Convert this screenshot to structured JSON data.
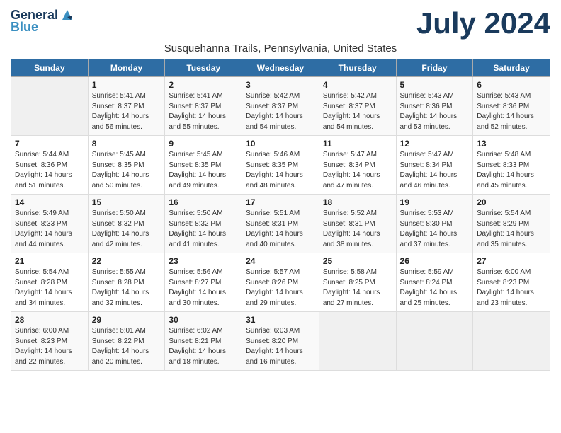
{
  "logo": {
    "text_general": "General",
    "text_blue": "Blue"
  },
  "title": "July 2024",
  "subtitle": "Susquehanna Trails, Pennsylvania, United States",
  "days_of_week": [
    "Sunday",
    "Monday",
    "Tuesday",
    "Wednesday",
    "Thursday",
    "Friday",
    "Saturday"
  ],
  "weeks": [
    [
      {
        "date": "",
        "info": ""
      },
      {
        "date": "1",
        "info": "Sunrise: 5:41 AM\nSunset: 8:37 PM\nDaylight: 14 hours\nand 56 minutes."
      },
      {
        "date": "2",
        "info": "Sunrise: 5:41 AM\nSunset: 8:37 PM\nDaylight: 14 hours\nand 55 minutes."
      },
      {
        "date": "3",
        "info": "Sunrise: 5:42 AM\nSunset: 8:37 PM\nDaylight: 14 hours\nand 54 minutes."
      },
      {
        "date": "4",
        "info": "Sunrise: 5:42 AM\nSunset: 8:37 PM\nDaylight: 14 hours\nand 54 minutes."
      },
      {
        "date": "5",
        "info": "Sunrise: 5:43 AM\nSunset: 8:36 PM\nDaylight: 14 hours\nand 53 minutes."
      },
      {
        "date": "6",
        "info": "Sunrise: 5:43 AM\nSunset: 8:36 PM\nDaylight: 14 hours\nand 52 minutes."
      }
    ],
    [
      {
        "date": "7",
        "info": "Sunrise: 5:44 AM\nSunset: 8:36 PM\nDaylight: 14 hours\nand 51 minutes."
      },
      {
        "date": "8",
        "info": "Sunrise: 5:45 AM\nSunset: 8:35 PM\nDaylight: 14 hours\nand 50 minutes."
      },
      {
        "date": "9",
        "info": "Sunrise: 5:45 AM\nSunset: 8:35 PM\nDaylight: 14 hours\nand 49 minutes."
      },
      {
        "date": "10",
        "info": "Sunrise: 5:46 AM\nSunset: 8:35 PM\nDaylight: 14 hours\nand 48 minutes."
      },
      {
        "date": "11",
        "info": "Sunrise: 5:47 AM\nSunset: 8:34 PM\nDaylight: 14 hours\nand 47 minutes."
      },
      {
        "date": "12",
        "info": "Sunrise: 5:47 AM\nSunset: 8:34 PM\nDaylight: 14 hours\nand 46 minutes."
      },
      {
        "date": "13",
        "info": "Sunrise: 5:48 AM\nSunset: 8:33 PM\nDaylight: 14 hours\nand 45 minutes."
      }
    ],
    [
      {
        "date": "14",
        "info": "Sunrise: 5:49 AM\nSunset: 8:33 PM\nDaylight: 14 hours\nand 44 minutes."
      },
      {
        "date": "15",
        "info": "Sunrise: 5:50 AM\nSunset: 8:32 PM\nDaylight: 14 hours\nand 42 minutes."
      },
      {
        "date": "16",
        "info": "Sunrise: 5:50 AM\nSunset: 8:32 PM\nDaylight: 14 hours\nand 41 minutes."
      },
      {
        "date": "17",
        "info": "Sunrise: 5:51 AM\nSunset: 8:31 PM\nDaylight: 14 hours\nand 40 minutes."
      },
      {
        "date": "18",
        "info": "Sunrise: 5:52 AM\nSunset: 8:31 PM\nDaylight: 14 hours\nand 38 minutes."
      },
      {
        "date": "19",
        "info": "Sunrise: 5:53 AM\nSunset: 8:30 PM\nDaylight: 14 hours\nand 37 minutes."
      },
      {
        "date": "20",
        "info": "Sunrise: 5:54 AM\nSunset: 8:29 PM\nDaylight: 14 hours\nand 35 minutes."
      }
    ],
    [
      {
        "date": "21",
        "info": "Sunrise: 5:54 AM\nSunset: 8:28 PM\nDaylight: 14 hours\nand 34 minutes."
      },
      {
        "date": "22",
        "info": "Sunrise: 5:55 AM\nSunset: 8:28 PM\nDaylight: 14 hours\nand 32 minutes."
      },
      {
        "date": "23",
        "info": "Sunrise: 5:56 AM\nSunset: 8:27 PM\nDaylight: 14 hours\nand 30 minutes."
      },
      {
        "date": "24",
        "info": "Sunrise: 5:57 AM\nSunset: 8:26 PM\nDaylight: 14 hours\nand 29 minutes."
      },
      {
        "date": "25",
        "info": "Sunrise: 5:58 AM\nSunset: 8:25 PM\nDaylight: 14 hours\nand 27 minutes."
      },
      {
        "date": "26",
        "info": "Sunrise: 5:59 AM\nSunset: 8:24 PM\nDaylight: 14 hours\nand 25 minutes."
      },
      {
        "date": "27",
        "info": "Sunrise: 6:00 AM\nSunset: 8:23 PM\nDaylight: 14 hours\nand 23 minutes."
      }
    ],
    [
      {
        "date": "28",
        "info": "Sunrise: 6:00 AM\nSunset: 8:23 PM\nDaylight: 14 hours\nand 22 minutes."
      },
      {
        "date": "29",
        "info": "Sunrise: 6:01 AM\nSunset: 8:22 PM\nDaylight: 14 hours\nand 20 minutes."
      },
      {
        "date": "30",
        "info": "Sunrise: 6:02 AM\nSunset: 8:21 PM\nDaylight: 14 hours\nand 18 minutes."
      },
      {
        "date": "31",
        "info": "Sunrise: 6:03 AM\nSunset: 8:20 PM\nDaylight: 14 hours\nand 16 minutes."
      },
      {
        "date": "",
        "info": ""
      },
      {
        "date": "",
        "info": ""
      },
      {
        "date": "",
        "info": ""
      }
    ]
  ]
}
